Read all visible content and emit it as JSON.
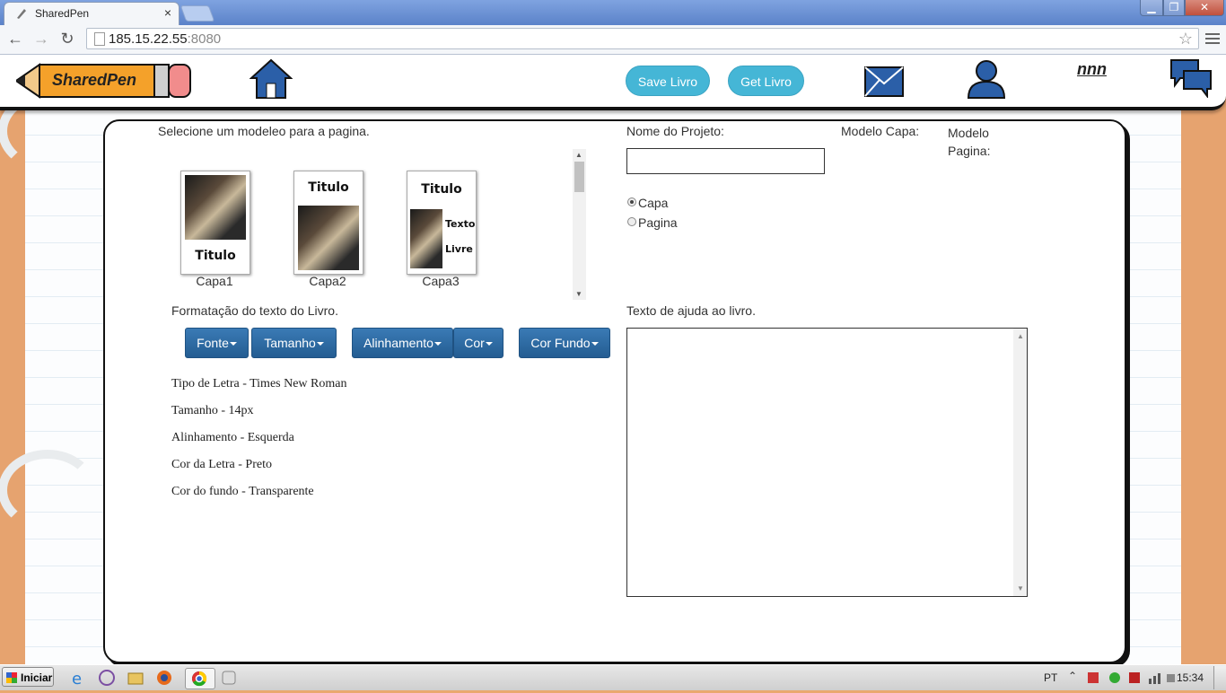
{
  "browser": {
    "tab_title": "SharedPen",
    "tab_close": "×",
    "url_host": "185.15.22.55",
    "url_port": ":8080",
    "back_glyph": "←",
    "forward_glyph": "→",
    "reload_glyph": "↻",
    "star_glyph": "☆",
    "win_min": "▁",
    "win_max": "❐",
    "win_close": "✕"
  },
  "header": {
    "logo_text": "SharedPen",
    "save_label": "Save Livro",
    "get_label": "Get Livro",
    "user_name": "nnn",
    "icons": [
      "home-icon",
      "mail-icon",
      "user-profile-icon",
      "chat-icon"
    ]
  },
  "model_select": {
    "heading": "Selecione um modeleo para a pagina.",
    "covers": [
      {
        "caption": "Capa1",
        "title": "Titulo"
      },
      {
        "caption": "Capa2",
        "title": "Titulo"
      },
      {
        "caption": "Capa3",
        "title": "Titulo",
        "text1": "Texto",
        "text2": "Livre"
      }
    ]
  },
  "project": {
    "name_label": "Nome do Projeto:",
    "name_value": "",
    "capa_model_label": "Modelo Capa:",
    "page_model_label": "Modelo Pagina:",
    "radio_capa": "Capa",
    "radio_pagina": "Pagina",
    "selected": "Capa"
  },
  "formatting": {
    "heading": "Formatação do texto do Livro.",
    "buttons": {
      "fonte": "Fonte",
      "tamanho": "Tamanho",
      "alinhamento": "Alinhamento",
      "cor": "Cor",
      "cor_fundo": "Cor Fundo"
    },
    "current": {
      "font": "Tipo de Letra - Times New Roman",
      "size": "Tamanho - 14px",
      "align": "Alinhamento - Esquerda",
      "color": "Cor da Letra - Preto",
      "background": "Cor do fundo - Transparente"
    }
  },
  "help": {
    "heading": "Texto de ajuda ao livro.",
    "value": ""
  },
  "taskbar": {
    "start_label": "Iniciar",
    "lang": "PT",
    "clock": "15:34"
  },
  "colors": {
    "accent_button": "#45b6d6",
    "format_button": "#2d6aa3",
    "side_orange": "#e6a36f"
  }
}
